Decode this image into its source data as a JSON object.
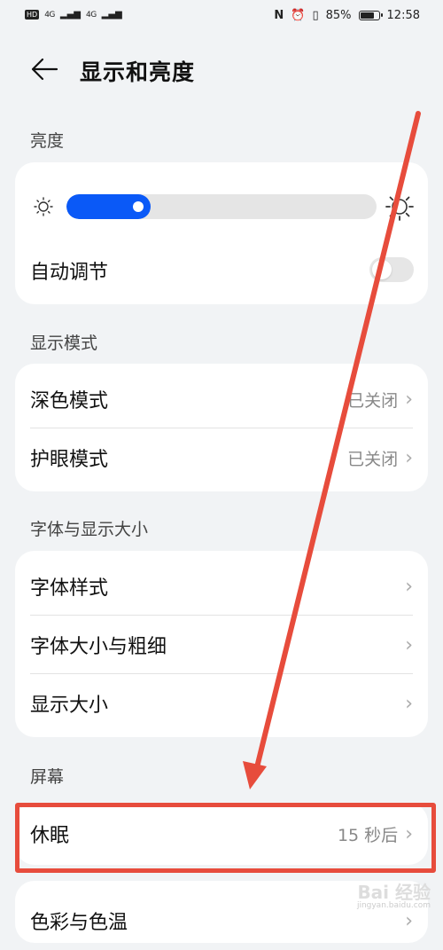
{
  "status_bar": {
    "hd": "HD",
    "net1": "4G",
    "net2": "4G",
    "battery": "85%",
    "battery_level": 0.85,
    "time": "12:58"
  },
  "header": {
    "title": "显示和亮度"
  },
  "sections": {
    "brightness": {
      "label": "亮度",
      "level": 0.27,
      "auto_label": "自动调节",
      "auto_on": false
    },
    "display_mode": {
      "label": "显示模式",
      "items": [
        {
          "label": "深色模式",
          "value": "已关闭"
        },
        {
          "label": "护眼模式",
          "value": "已关闭"
        }
      ]
    },
    "font_display": {
      "label": "字体与显示大小",
      "items": [
        {
          "label": "字体样式"
        },
        {
          "label": "字体大小与粗细"
        },
        {
          "label": "显示大小"
        }
      ]
    },
    "screen": {
      "label": "屏幕",
      "items": [
        {
          "label": "休眠",
          "value": "15 秒后"
        },
        {
          "label": "色彩与色温"
        }
      ]
    }
  },
  "watermark": {
    "text": "Bai 经验",
    "sub": "jingyan.baidu.com"
  },
  "colors": {
    "accent": "#0a59f7",
    "annotation": "#e74c3c"
  }
}
